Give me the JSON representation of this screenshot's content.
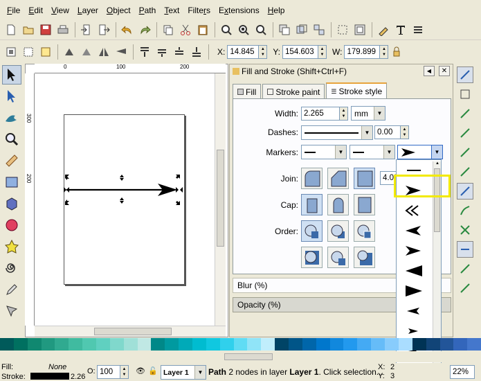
{
  "menu": [
    "File",
    "Edit",
    "View",
    "Layer",
    "Object",
    "Path",
    "Text",
    "Filters",
    "Extensions",
    "Help"
  ],
  "menu_underline": [
    "F",
    "E",
    "V",
    "L",
    "O",
    "P",
    "T",
    "r",
    "x",
    "H"
  ],
  "coords": {
    "x_label": "X:",
    "x_value": "14.845",
    "y_label": "Y:",
    "y_value": "154.603",
    "w_label": "W:",
    "w_value": "179.899"
  },
  "ruler": {
    "h_ticks": [
      "0",
      "100",
      "200"
    ],
    "v_ticks": [
      "300",
      "200"
    ]
  },
  "panel": {
    "title": "Fill and Stroke (Shift+Ctrl+F)",
    "tabs": [
      "Fill",
      "Stroke paint",
      "Stroke style"
    ],
    "width_label": "Width:",
    "width_value": "2.265",
    "unit": "mm",
    "dashes_label": "Dashes:",
    "dashes_offset": "0.00",
    "markers_label": "Markers:",
    "join_label": "Join:",
    "miter_value": "4.00",
    "cap_label": "Cap:",
    "order_label": "Order:",
    "blur_label": "Blur (%)",
    "opacity_label": "Opacity (%)"
  },
  "status": {
    "fill_label": "Fill:",
    "fill_value": "None",
    "stroke_label": "Stroke:",
    "stroke_width": "2.26",
    "opacity_label": "O:",
    "opacity_value": "100",
    "layer": "Layer 1",
    "msg_prefix": "Path",
    "msg_rest": " 2 nodes in layer ",
    "msg_layer": "Layer 1",
    "msg_tail": ". Click selection...",
    "cursor_x_label": "X:",
    "cursor_x": "2",
    "cursor_y_label": "Y:",
    "cursor_y": "3",
    "zoom": "22%"
  },
  "palette_colors": [
    "#005a5a",
    "#007060",
    "#108870",
    "#209980",
    "#30aa90",
    "#40bba0",
    "#50c8b0",
    "#60d0c0",
    "#80d8cc",
    "#a0e0d8",
    "#c0e8e4",
    "#008888",
    "#009aa0",
    "#00aab8",
    "#00bcd0",
    "#10c8e0",
    "#30d0ec",
    "#60dcf4",
    "#90e4f8",
    "#c0eefc",
    "#004466",
    "#005588",
    "#0066aa",
    "#0077cc",
    "#1188dd",
    "#2299ee",
    "#44aaf4",
    "#66bcf8",
    "#88ccfc",
    "#aaddff",
    "#003355",
    "#114477",
    "#225599",
    "#3366bb",
    "#4477cc"
  ]
}
